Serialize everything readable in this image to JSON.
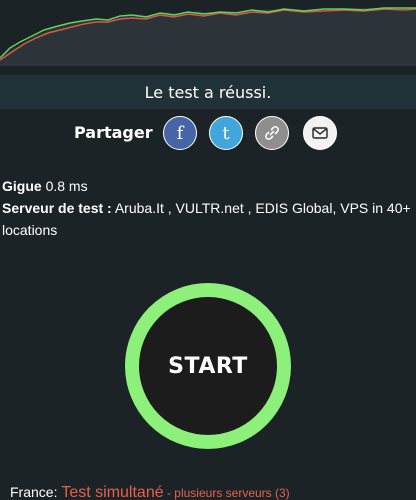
{
  "status": {
    "message": "Le test a réussi."
  },
  "share": {
    "label": "Partager",
    "buttons": [
      {
        "icon": "facebook-icon",
        "glyph": "f",
        "color": "#4764a6"
      },
      {
        "icon": "twitter-icon",
        "glyph": "t",
        "color": "#42a6dc"
      },
      {
        "icon": "link-icon",
        "color": "#8e8e8e"
      },
      {
        "icon": "mail-icon",
        "color": "#f2f2f2"
      }
    ]
  },
  "jitter": {
    "label": "Gigue",
    "value": "0.8 ms"
  },
  "servers": {
    "label": "Serveur de test :",
    "list_line1": "Aruba.It  ,  VULTR.net ,  EDIS Global, VPS in 40+",
    "list_line2": "locations"
  },
  "start_button": {
    "label": "START",
    "ring_color": "#8df07a"
  },
  "footer": {
    "country": "France:",
    "simultaneous": "Test simultané",
    "multi": " - plusieurs serveurs (3)"
  },
  "colors": {
    "download_line": "#5fd35a",
    "upload_line": "#d6584a",
    "background": "#1b2326",
    "accent_red": "#e8604c"
  }
}
